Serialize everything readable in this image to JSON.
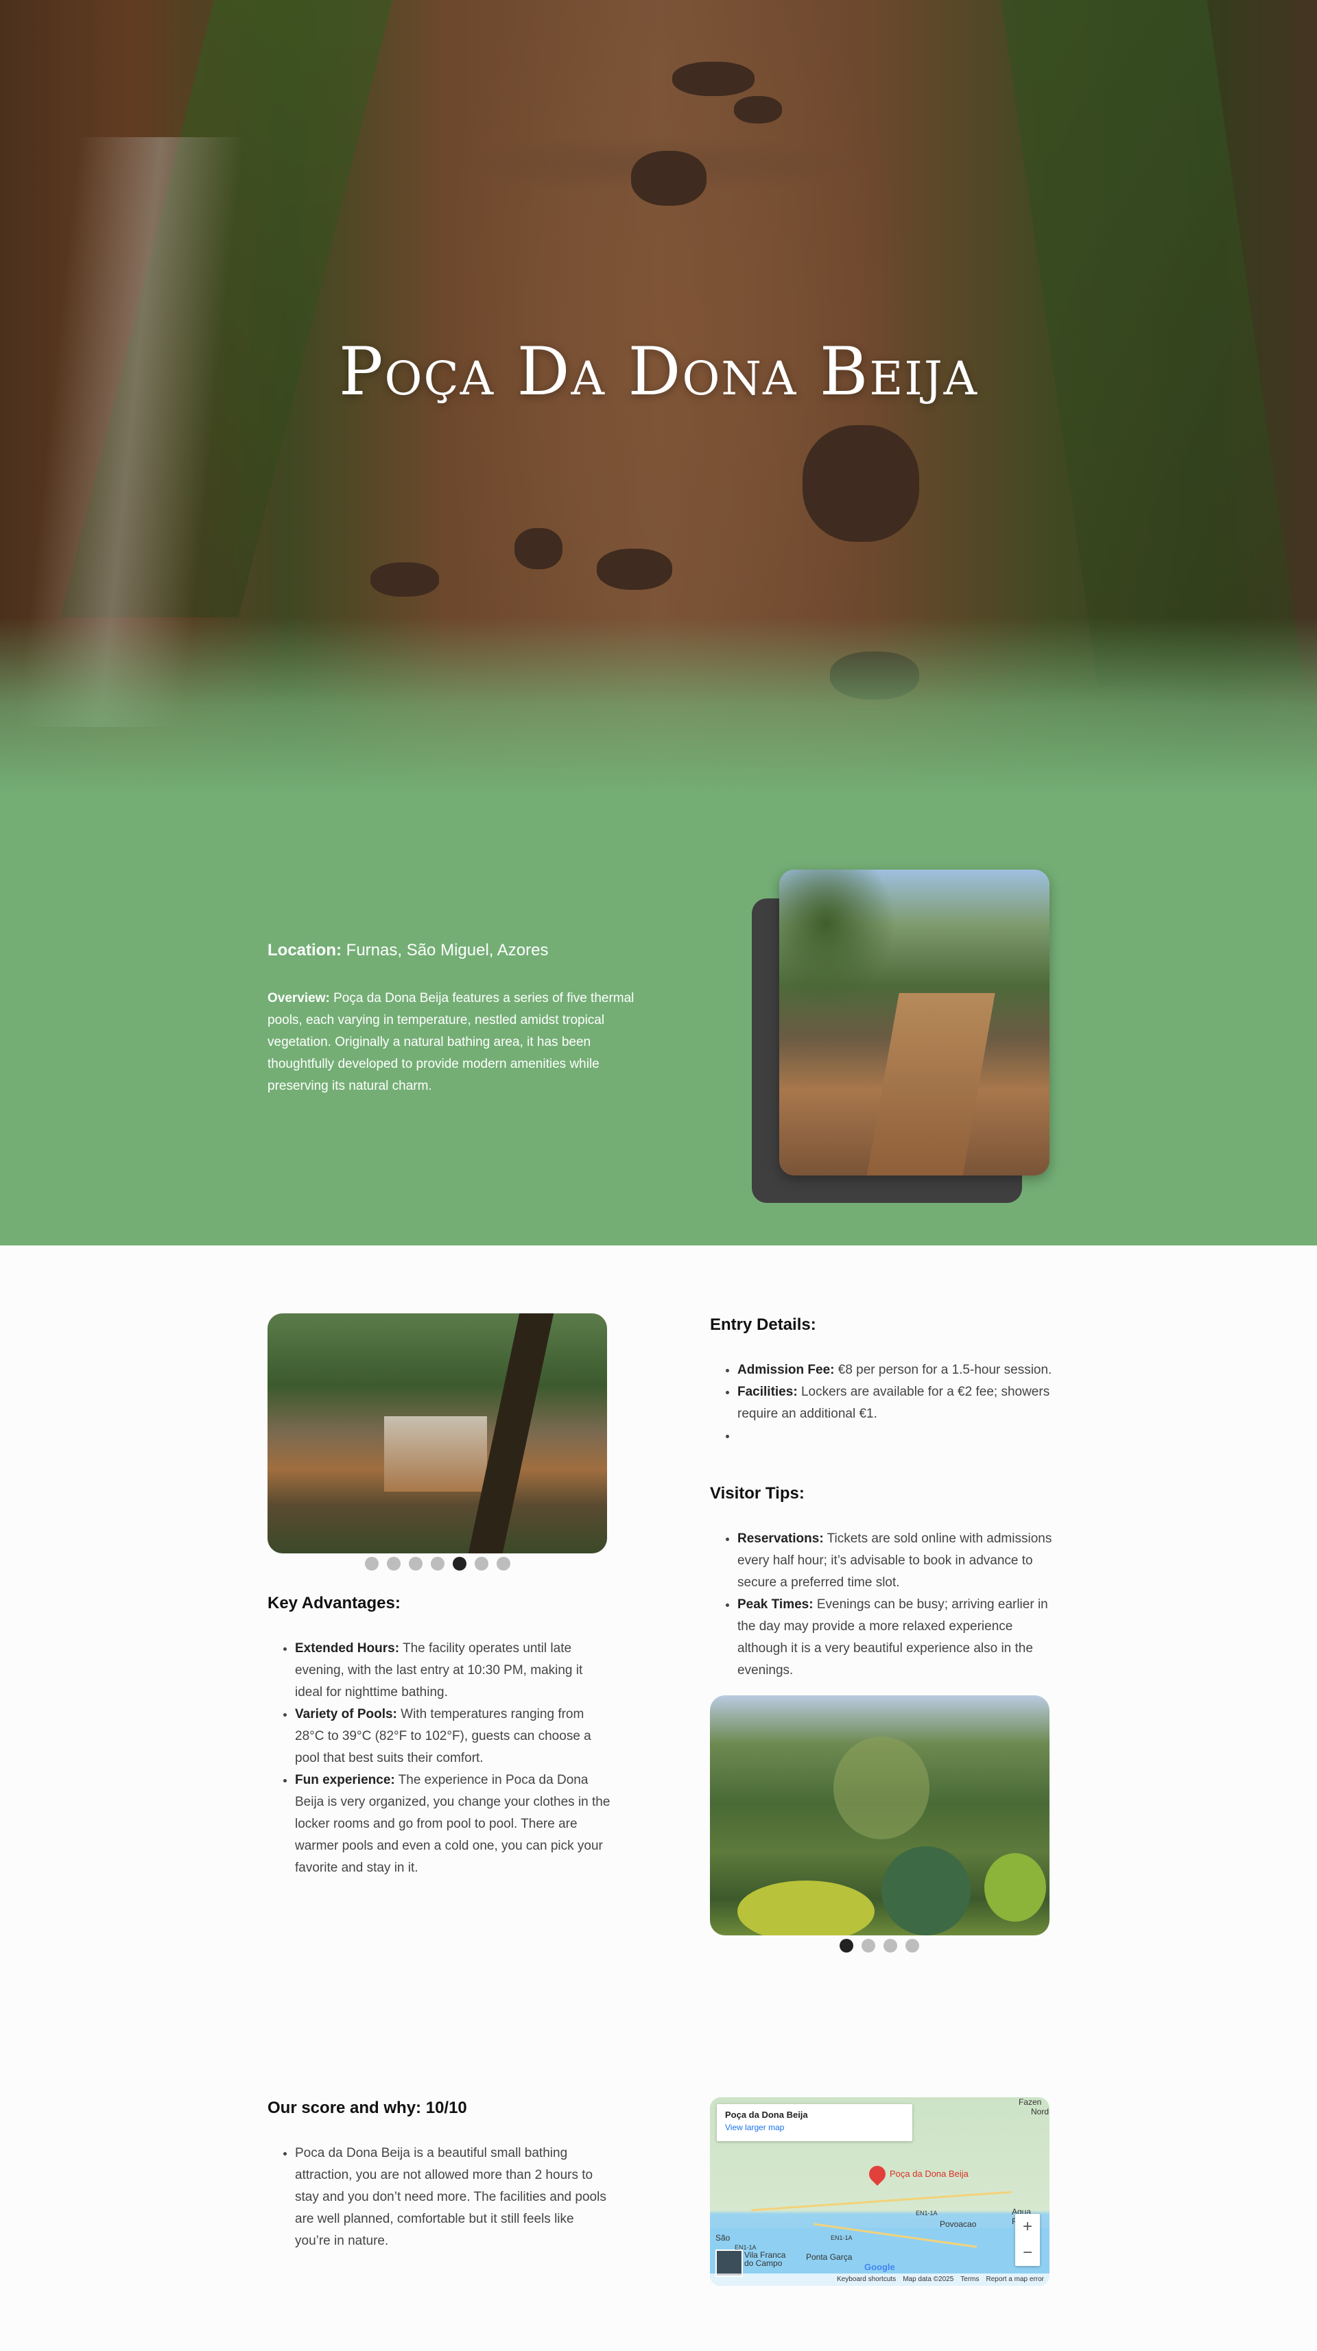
{
  "hero": {
    "title": "Poça Da Dona Beija"
  },
  "intro": {
    "location_label": "Location:",
    "location_value": "Furnas, São Miguel, Azores",
    "overview_label": "Overview:",
    "overview_text": "Poça da Dona Beija features a series of five thermal pools, each varying in temperature, nestled amidst tropical vegetation. Originally a natural bathing area, it has been thoughtfully developed to provide modern amenities while preserving its natural charm."
  },
  "gallery_left": {
    "dots": 7,
    "active_index": 4
  },
  "gallery_right": {
    "dots": 4,
    "active_index": 0
  },
  "key_advantages": {
    "heading": "Key Advantages:",
    "items": [
      {
        "label": "Extended Hours:",
        "text": "The facility operates until late evening, with the last entry at 10:30 PM, making it ideal for nighttime bathing."
      },
      {
        "label": "Variety of Pools:",
        "text": "With temperatures ranging from 28°C to 39°C (82°F to 102°F), guests can choose a pool that best suits their comfort."
      },
      {
        "label": "Fun experience:",
        "text": "The experience in Poca da Dona Beija is very organized, you change your clothes in the locker rooms and go from pool to pool. There are warmer pools and even a cold one, you can pick your favorite and stay in it."
      }
    ]
  },
  "entry_details": {
    "heading": "Entry Details:",
    "items": [
      {
        "label": "Admission Fee:",
        "text": "€8 per person for a 1.5-hour session."
      },
      {
        "label": "Facilities:",
        "text": "Lockers are available for a €2 fee; showers require an additional €1."
      }
    ]
  },
  "visitor_tips": {
    "heading": "Visitor Tips:",
    "items": [
      {
        "label": "Reservations:",
        "text": "Tickets are sold online with admissions every half hour; it’s advisable to book in advance to secure a preferred time slot."
      },
      {
        "label": "Peak Times:",
        "text": "Evenings can be busy; arriving earlier in the day may provide a more relaxed experience although it is a very beautiful experience also in the evenings."
      }
    ]
  },
  "score": {
    "heading": "Our score and why: 10/10",
    "text": "Poca da Dona Beija is a beautiful small bathing attraction, you are not allowed more than 2 hours to stay and you don’t need more. The facilities and pools are well planned, comfortable but it still feels like you’re in nature."
  },
  "map": {
    "place_name": "Poça da Dona Beija",
    "view_larger": "View larger map",
    "pin_label": "Poça da Dona Beija",
    "labels": [
      "Povoacao",
      "Agua Retorta",
      "Vila Franca do Campo",
      "Ponta Garça",
      "São",
      "Nord",
      "Fazen"
    ],
    "road_codes": [
      "EN1-1A",
      "EN1-1A",
      "EN1-1A"
    ],
    "zoom_in": "+",
    "zoom_out": "−",
    "logo": "Google",
    "footer": [
      "Keyboard shortcuts",
      "Map data ©2025",
      "Terms",
      "Report a map error"
    ]
  }
}
